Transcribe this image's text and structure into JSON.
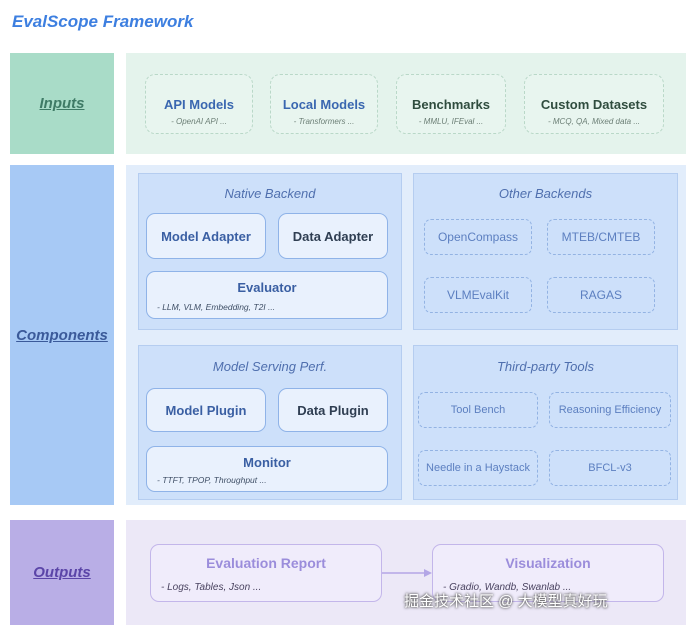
{
  "title": "EvalScope Framework",
  "rows": {
    "inputs": "Inputs",
    "components": "Components",
    "outputs": "Outputs"
  },
  "inputs": [
    {
      "name": "API Models",
      "sub": "- OpenAI API ..."
    },
    {
      "name": "Local Models",
      "sub": "- Transformers ..."
    },
    {
      "name": "Benchmarks",
      "sub": "- MMLU, IFEval ..."
    },
    {
      "name": "Custom Datasets",
      "sub": "- MCQ, QA, Mixed data ..."
    }
  ],
  "native_backend": {
    "title": "Native Backend",
    "model_adapter": "Model Adapter",
    "data_adapter": "Data Adapter",
    "evaluator": "Evaluator",
    "evaluator_sub": "- LLM, VLM, Embedding, T2I ..."
  },
  "other_backends": {
    "title": "Other Backends",
    "items": [
      "OpenCompass",
      "MTEB/CMTEB",
      "VLMEvalKit",
      "RAGAS"
    ]
  },
  "serving_perf": {
    "title": "Model  Serving Perf.",
    "model_plugin": "Model Plugin",
    "data_plugin": "Data Plugin",
    "monitor": "Monitor",
    "monitor_sub": "- TTFT, TPOP, Throughput ..."
  },
  "third_party": {
    "title": "Third-party Tools",
    "items": [
      "Tool Bench",
      "Reasoning Efficiency",
      "Needle in a Haystack",
      "BFCL-v3"
    ]
  },
  "outputs": {
    "report": "Evaluation Report",
    "report_sub": "- Logs, Tables, Json ...",
    "visualization": "Visualization",
    "visualization_sub": "- Gradio, Wandb, Swanlab ..."
  },
  "watermark": "掘金技术社区 @ 大模型真好玩"
}
